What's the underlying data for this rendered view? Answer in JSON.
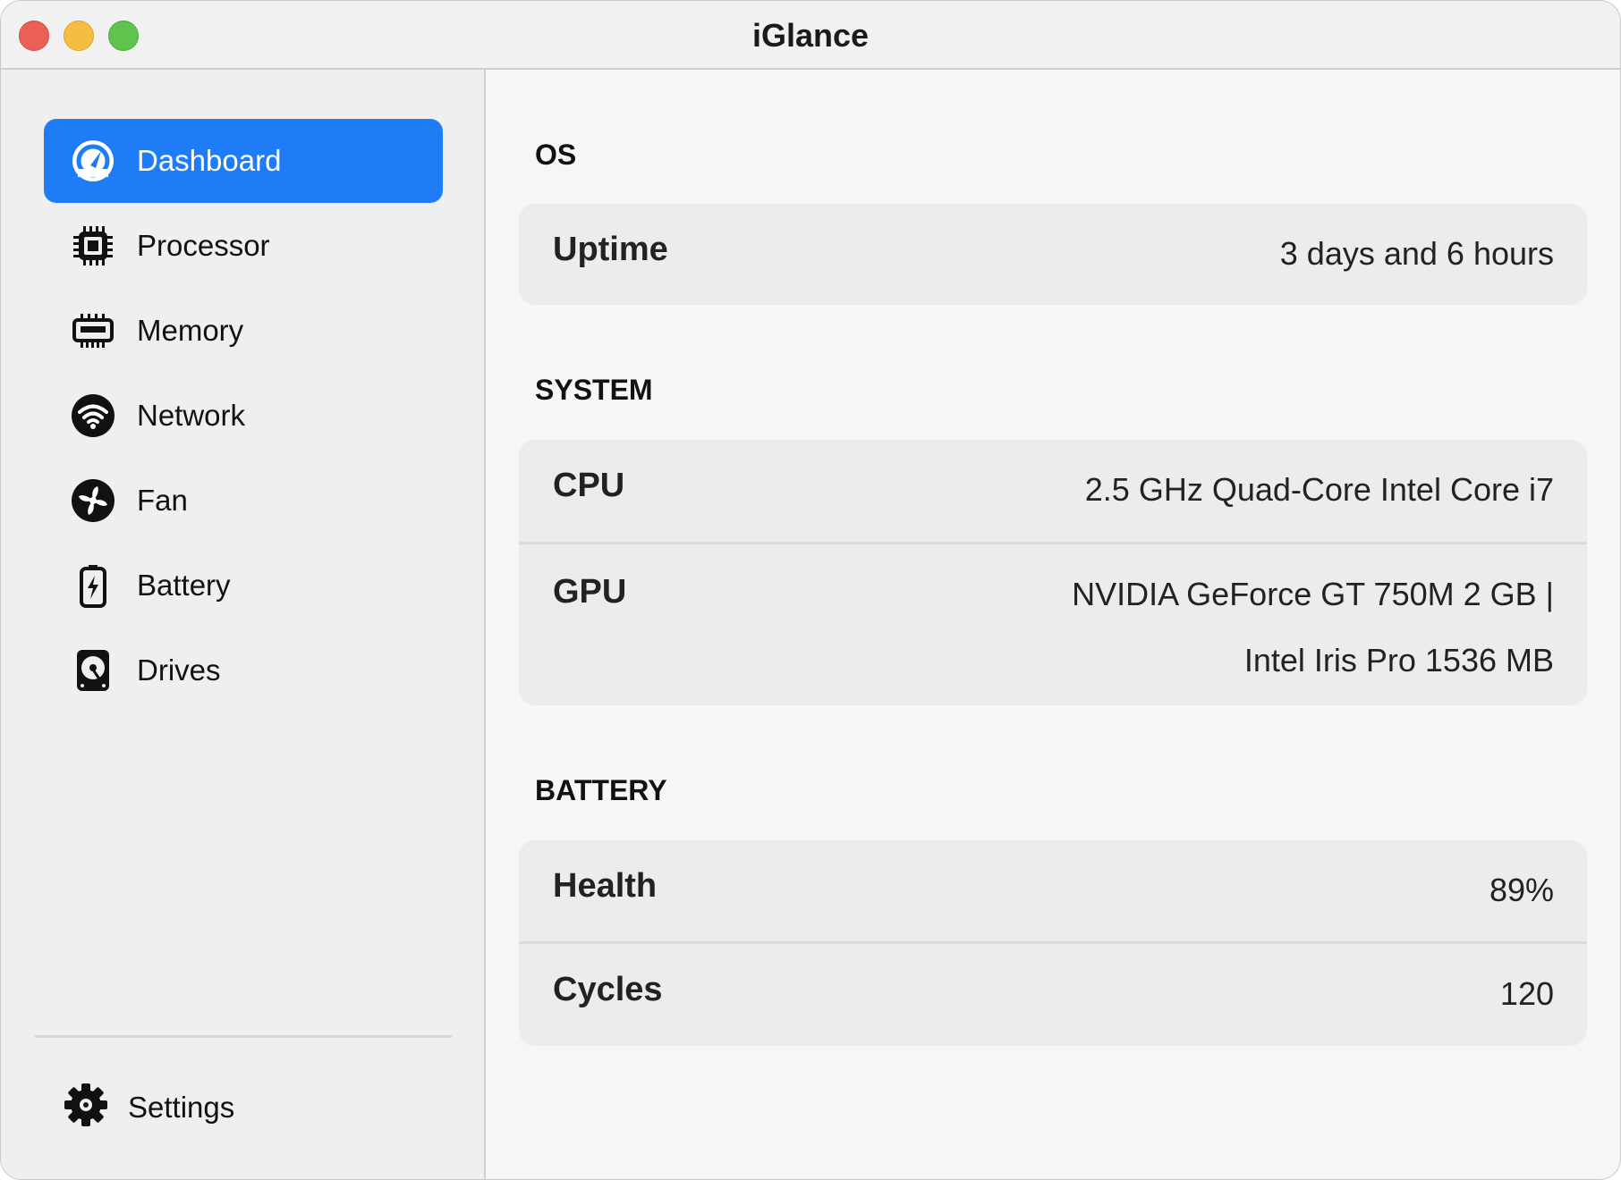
{
  "window": {
    "title": "iGlance"
  },
  "sidebar": {
    "items": [
      {
        "label": "Dashboard",
        "icon": "dashboard-gauge-icon"
      },
      {
        "label": "Processor",
        "icon": "processor-chip-icon"
      },
      {
        "label": "Memory",
        "icon": "memory-ram-icon"
      },
      {
        "label": "Network",
        "icon": "wifi-icon"
      },
      {
        "label": "Fan",
        "icon": "fan-icon"
      },
      {
        "label": "Battery",
        "icon": "battery-icon"
      },
      {
        "label": "Drives",
        "icon": "drive-icon"
      }
    ],
    "settings": {
      "label": "Settings",
      "icon": "gear-icon"
    }
  },
  "main": {
    "os": {
      "title": "OS",
      "rows": [
        {
          "label": "Uptime",
          "value": "3 days and 6 hours"
        }
      ]
    },
    "system": {
      "title": "SYSTEM",
      "rows": [
        {
          "label": "CPU",
          "value": "2.5 GHz Quad-Core Intel Core i7"
        },
        {
          "label": "GPU",
          "value_line1": "NVIDIA GeForce GT 750M 2 GB |",
          "value_line2": "Intel Iris Pro 1536 MB"
        }
      ]
    },
    "battery": {
      "title": "BATTERY",
      "rows": [
        {
          "label": "Health",
          "value": "89%"
        },
        {
          "label": "Cycles",
          "value": "120"
        }
      ]
    }
  },
  "colors": {
    "accent": "#1f7cf7",
    "close": "#ec5f57",
    "minimize": "#f2bd40",
    "maximize": "#5fc44d"
  }
}
